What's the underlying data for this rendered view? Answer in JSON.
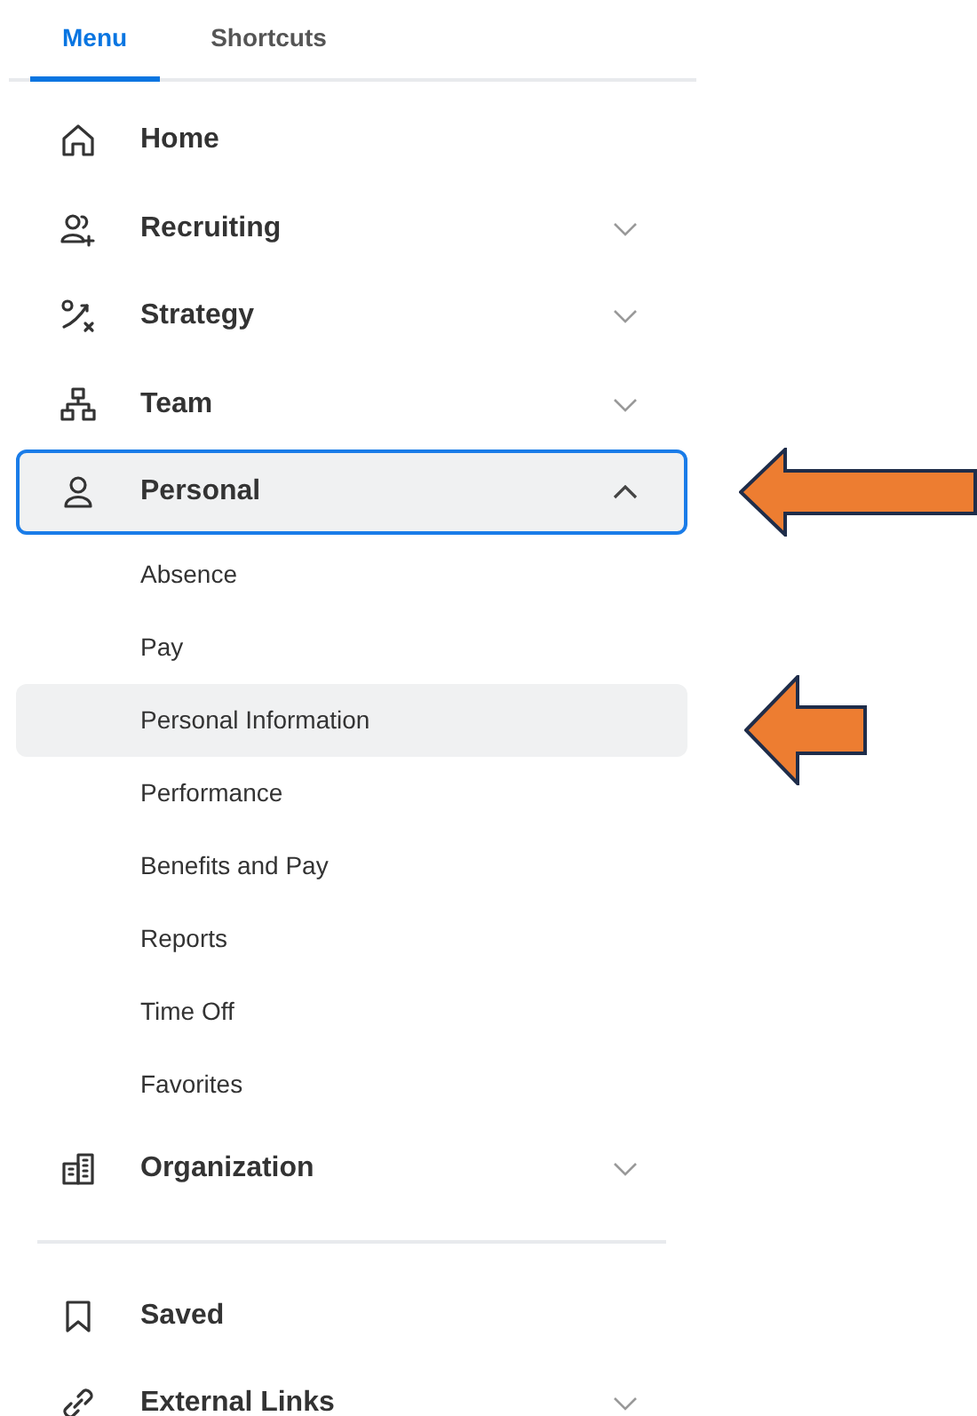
{
  "tabs": [
    {
      "label": "Menu",
      "selected": true
    },
    {
      "label": "Shortcuts",
      "selected": false
    }
  ],
  "sections": [
    {
      "items": [
        {
          "label": "Home",
          "expandable": false,
          "focused": false
        },
        {
          "label": "Recruiting",
          "expandable": true,
          "expanded": false,
          "focused": false
        },
        {
          "label": "Strategy",
          "expandable": true,
          "expanded": false,
          "focused": false
        },
        {
          "label": "Team",
          "expandable": true,
          "expanded": false,
          "focused": false
        },
        {
          "label": "Personal",
          "expandable": true,
          "expanded": true,
          "focused": true,
          "arrow": true,
          "children": [
            {
              "label": "Absence",
              "selected": false
            },
            {
              "label": "Pay",
              "selected": false
            },
            {
              "label": "Personal Information",
              "selected": true,
              "arrow": true
            },
            {
              "label": "Performance",
              "selected": false
            },
            {
              "label": "Benefits and Pay",
              "selected": false
            },
            {
              "label": "Reports",
              "selected": false
            },
            {
              "label": "Time Off",
              "selected": false
            },
            {
              "label": "Favorites",
              "selected": false
            }
          ]
        },
        {
          "label": "Organization",
          "expandable": true,
          "expanded": false,
          "focused": false
        }
      ]
    },
    {
      "items": [
        {
          "label": "Saved",
          "expandable": false,
          "focused": false
        },
        {
          "label": "External Links",
          "expandable": true,
          "expanded": false,
          "focused": false
        }
      ]
    }
  ]
}
